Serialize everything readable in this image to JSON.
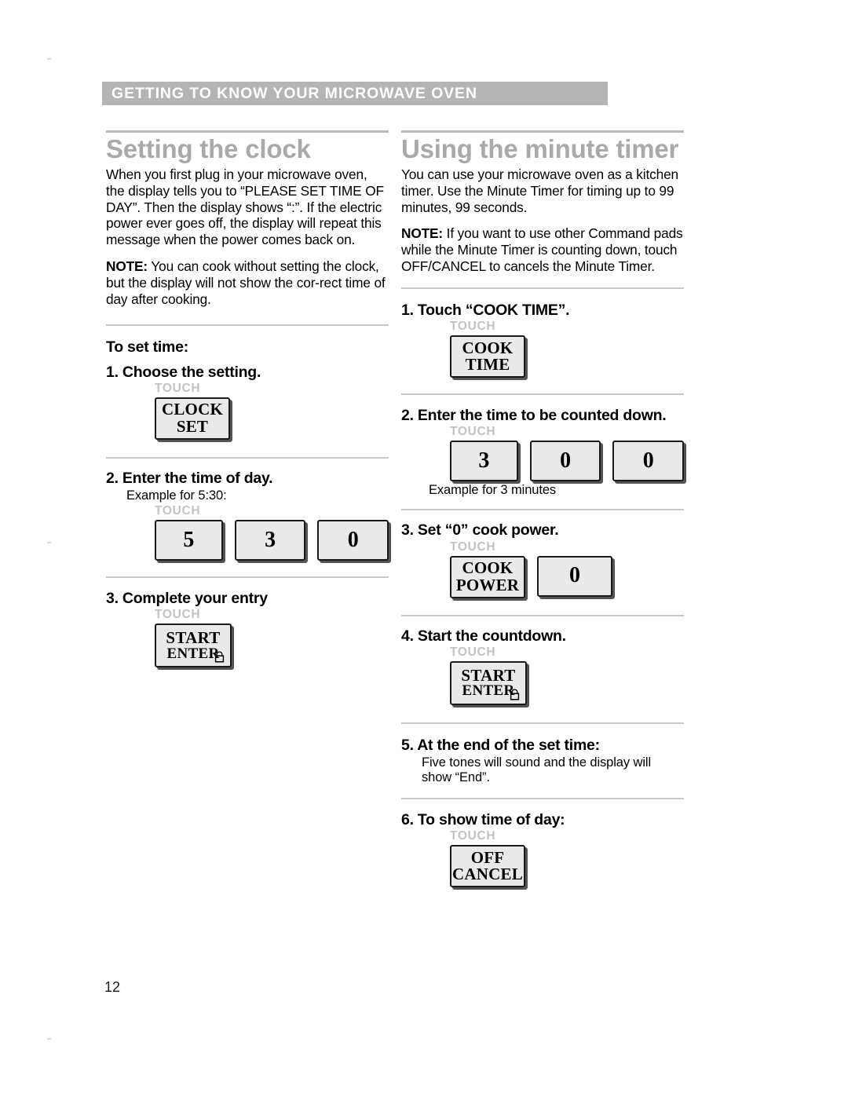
{
  "page": {
    "section_header": "GETTING TO KNOW YOUR MICROWAVE OVEN",
    "page_number": "12",
    "header_bar_color": "#b4b4b4",
    "heading_color": "#a9a9a9",
    "touch_label_color": "#c2c2c2",
    "key_fill_color": "#e9e9e9"
  },
  "left_column": {
    "title": "Setting the clock",
    "paragraphs": [
      "When you first plug in your microwave oven, the display tells you to “PLEASE SET TIME OF DAY”. Then the display shows “:”. If the electric power ever goes off, the display will repeat this message when the power comes back on.",
      "You can cook without setting the clock, but the display will not show the cor-rect time of day after cooking."
    ],
    "note_prefix": "NOTE:",
    "subhead": "To set time:",
    "steps": [
      {
        "head": "1. Choose the setting.",
        "touch": "TOUCH",
        "keys": [
          {
            "type": "word",
            "line1": "CLOCK",
            "line2": "SET"
          }
        ]
      },
      {
        "head": "2. Enter the time of day.",
        "example": "Example for 5:30:",
        "touch": "TOUCH",
        "keys": [
          {
            "type": "num",
            "label": "5"
          },
          {
            "type": "num",
            "label": "3"
          },
          {
            "type": "num",
            "label": "0"
          }
        ]
      },
      {
        "head": "3. Complete your entry",
        "touch": "TOUCH",
        "keys": [
          {
            "type": "start",
            "line1": "START",
            "line2": "ENTER",
            "icon": "padlock-icon"
          }
        ]
      }
    ]
  },
  "right_column": {
    "title": "Using the minute timer",
    "paragraphs": [
      "You can use your microwave oven as a kitchen timer. Use the Minute Timer for timing up to 99 minutes, 99 seconds.",
      "If you want to use other Command pads while the Minute Timer is counting down, touch OFF/CANCEL to cancels the Minute Timer."
    ],
    "note_prefix": "NOTE:",
    "steps": [
      {
        "head": "1. Touch “COOK TIME”.",
        "touch": "TOUCH",
        "keys": [
          {
            "type": "word",
            "line1": "COOK",
            "line2": "TIME"
          }
        ]
      },
      {
        "head": "2. Enter the time to be counted down.",
        "touch": "TOUCH",
        "keys": [
          {
            "type": "num",
            "label": "3"
          },
          {
            "type": "num",
            "label": "0"
          },
          {
            "type": "num",
            "label": "0"
          }
        ],
        "caption": "Example for 3 minutes"
      },
      {
        "head": "3. Set “0” cook power.",
        "touch": "TOUCH",
        "keys": [
          {
            "type": "word",
            "line1": "COOK",
            "line2": "POWER"
          },
          {
            "type": "num",
            "label": "0"
          }
        ]
      },
      {
        "head": "4. Start the countdown.",
        "touch": "TOUCH",
        "keys": [
          {
            "type": "start",
            "line1": "START",
            "line2": "ENTER",
            "icon": "padlock-icon"
          }
        ]
      },
      {
        "head": "5. At the end of the set time:",
        "body": "Five tones will sound and the display will show “End”."
      },
      {
        "head": "6. To show time of day:",
        "touch": "TOUCH",
        "keys": [
          {
            "type": "word",
            "line1": "OFF",
            "line2": "CANCEL"
          }
        ]
      }
    ]
  }
}
